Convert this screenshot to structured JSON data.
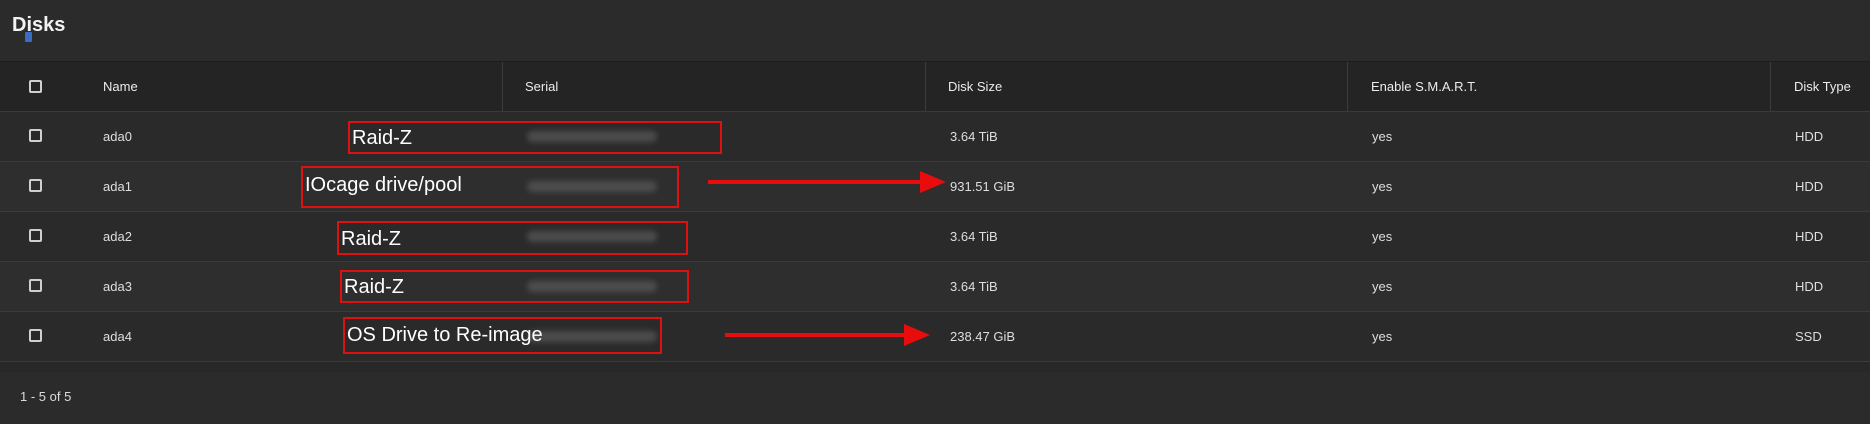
{
  "page": {
    "title": "Disks"
  },
  "columns": {
    "name": "Name",
    "serial": "Serial",
    "size": "Disk Size",
    "smart": "Enable S.M.A.R.T.",
    "type": "Disk Type"
  },
  "rows": [
    {
      "name": "ada0",
      "size": "3.64 TiB",
      "smart": "yes",
      "type": "HDD",
      "annotation": "Raid-Z"
    },
    {
      "name": "ada1",
      "size": "931.51 GiB",
      "smart": "yes",
      "type": "HDD",
      "annotation": "IOcage drive/pool"
    },
    {
      "name": "ada2",
      "size": "3.64 TiB",
      "smart": "yes",
      "type": "HDD",
      "annotation": "Raid-Z"
    },
    {
      "name": "ada3",
      "size": "3.64 TiB",
      "smart": "yes",
      "type": "HDD",
      "annotation": "Raid-Z"
    },
    {
      "name": "ada4",
      "size": "238.47 GiB",
      "smart": "yes",
      "type": "SSD",
      "annotation": "OS Drive to Re-image"
    }
  ],
  "footer": {
    "pagination": "1 - 5 of 5"
  },
  "colors": {
    "annotation": "#e01010",
    "background": "#282828"
  }
}
